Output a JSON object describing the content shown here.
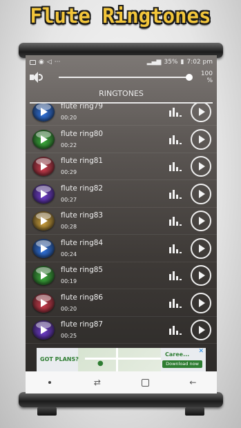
{
  "promo": {
    "title": "Flute Ringtones"
  },
  "statusbar": {
    "battery": "35%",
    "time": "7:02 pm"
  },
  "volume": {
    "percent_label": "100 %",
    "level": 1.0
  },
  "header": {
    "title": "RINGTONES"
  },
  "ringtones": [
    {
      "name": "flute ring79",
      "duration": "00:20",
      "color": "#2f6fd6"
    },
    {
      "name": "flute ring80",
      "duration": "00:22",
      "color": "#3aa63a"
    },
    {
      "name": "flute ring81",
      "duration": "00:29",
      "color": "#c43a4a"
    },
    {
      "name": "flute ring82",
      "duration": "00:27",
      "color": "#6a3ac4"
    },
    {
      "name": "flute ring83",
      "duration": "00:28",
      "color": "#c49a3a"
    },
    {
      "name": "flute ring84",
      "duration": "00:24",
      "color": "#2f6fd6"
    },
    {
      "name": "flute ring85",
      "duration": "00:19",
      "color": "#3aa63a"
    },
    {
      "name": "flute ring86",
      "duration": "00:20",
      "color": "#c43a4a"
    },
    {
      "name": "flute ring87",
      "duration": "00:25",
      "color": "#6a3ac4"
    }
  ],
  "ad": {
    "text": "GOT PLANS?",
    "brand": "Caree...",
    "cta": "Download now",
    "close": "✕"
  },
  "icons": {
    "status_left": [
      "image-icon",
      "whatsapp-icon",
      "share-icon",
      "more-icon"
    ],
    "bars": "equalizer-icon",
    "play": "play-icon"
  }
}
